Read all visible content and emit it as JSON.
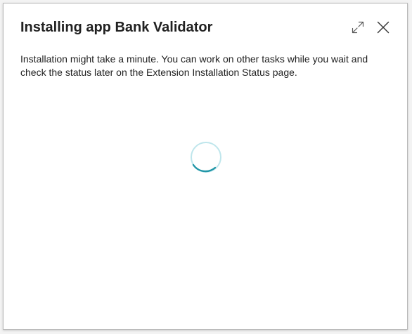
{
  "dialog": {
    "title": "Installing app Bank Validator",
    "message": "Installation might take a minute. You can work on other tasks while you wait and check the status later on the Extension Installation Status page.",
    "actions": {
      "expand_icon": "expand-icon",
      "close_icon": "close-icon"
    }
  },
  "spinner": {
    "icon": "loading-spinner",
    "track_color": "#bfe6ec",
    "arc_color": "#2196a7"
  }
}
